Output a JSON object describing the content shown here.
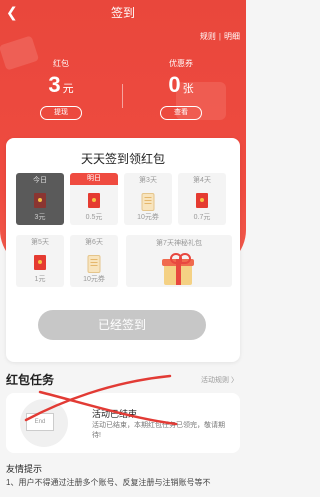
{
  "header": {
    "back_icon": "chevron-left-icon",
    "title": "签到",
    "rules_link": "规则",
    "detail_link": "明细"
  },
  "stats": {
    "hongbao": {
      "label": "红包",
      "value": "3",
      "unit": "元",
      "button": "提现"
    },
    "coupon": {
      "label": "优惠券",
      "value": "0",
      "unit": "张",
      "button": "查看"
    }
  },
  "card": {
    "title": "天天签到领红包",
    "days": [
      {
        "label": "今日",
        "value": "3元",
        "icon": "red-envelope-icon"
      },
      {
        "label": "明日",
        "value": "0.5元",
        "icon": "red-envelope-icon"
      },
      {
        "label": "第3天",
        "value": "10元券",
        "icon": "coupon-icon"
      },
      {
        "label": "第4天",
        "value": "0.7元",
        "icon": "red-envelope-icon"
      },
      {
        "label": "第5天",
        "value": "1元",
        "icon": "red-envelope-icon"
      },
      {
        "label": "第6天",
        "value": "10元券",
        "icon": "coupon-icon"
      }
    ],
    "day7": {
      "label": "第7天神秘礼包",
      "icon": "gift-icon"
    },
    "sign_button": "已经签到"
  },
  "task_section": {
    "title": "红包任务",
    "rules_link": "活动规则 〉",
    "end_badge": "End",
    "status": "活动已结束",
    "note": "活动已结束，本期红包任务已领完，敬请期待!"
  },
  "tips": {
    "title": "友情提示",
    "line1": "1、用户不得通过注册多个账号、反复注册与注销账号等不"
  },
  "colors": {
    "brand_red": "#ef4b40",
    "cross_red": "#e23b35",
    "disabled_button": "#c7c7c7"
  }
}
